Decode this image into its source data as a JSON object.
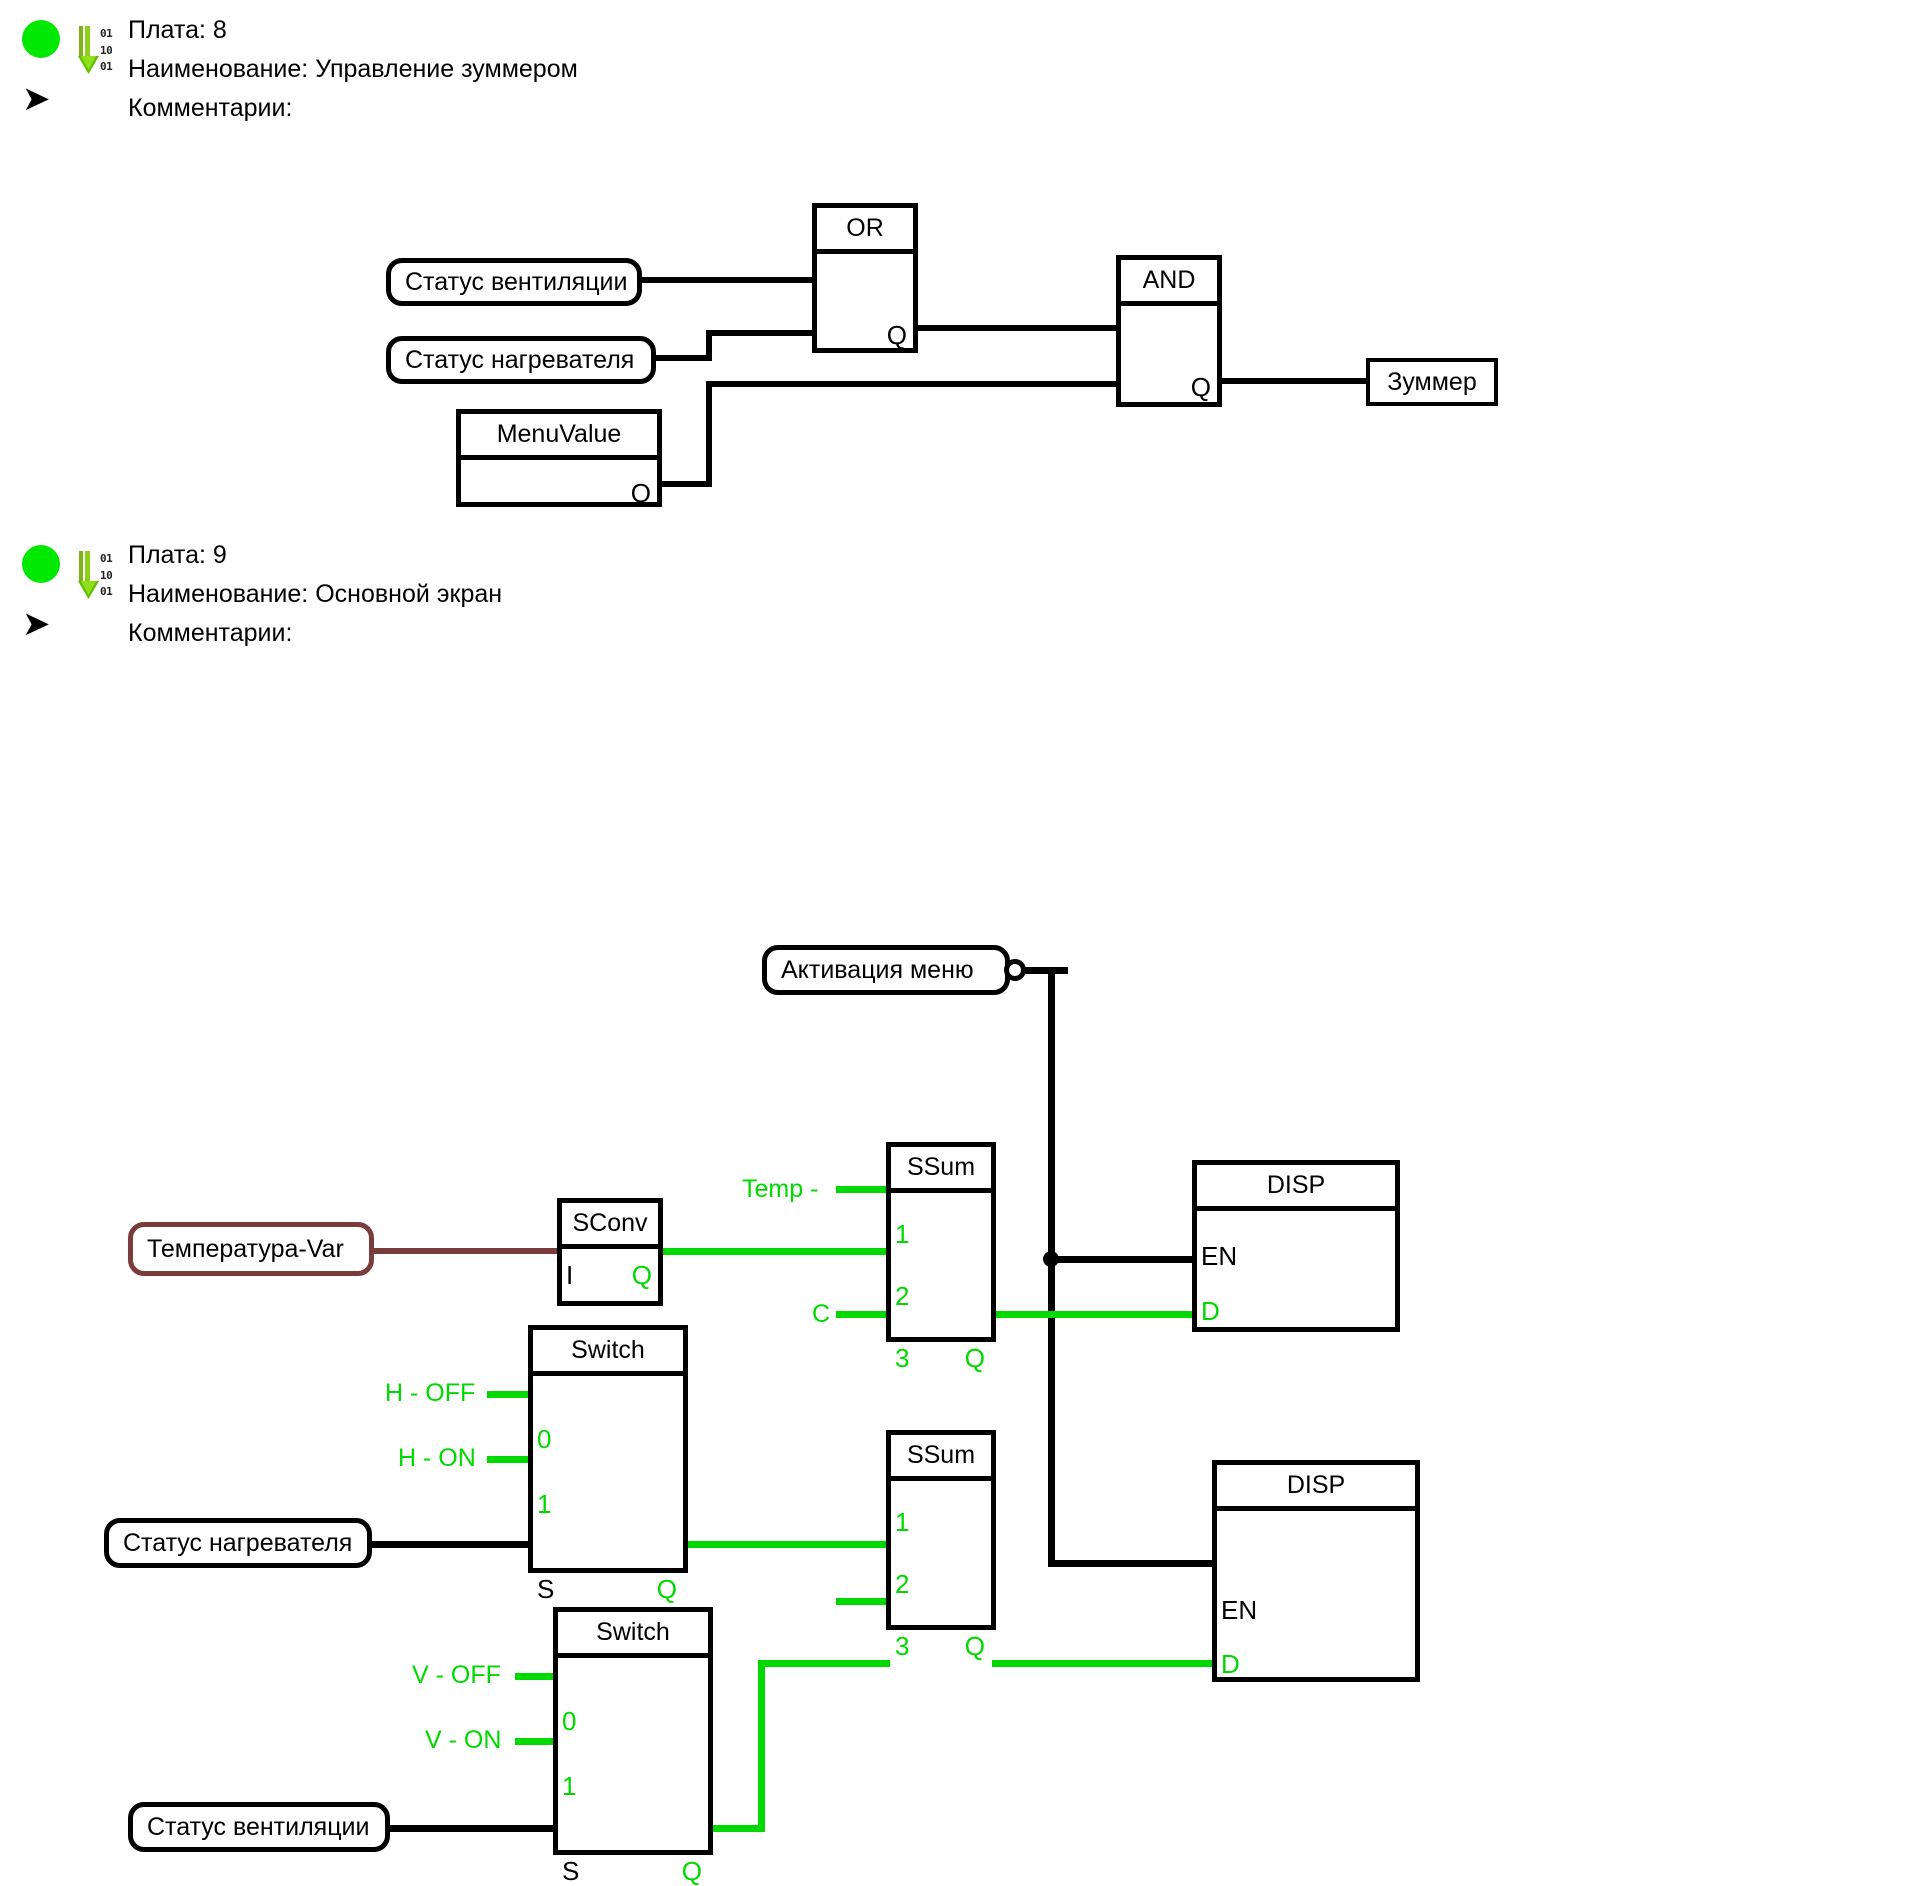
{
  "sections": [
    {
      "led_color": "#00E800",
      "icon_binary_rows": [
        "01",
        "10",
        "01"
      ],
      "lines": [
        "Плата: 8",
        "Наименование: Управление зуммером",
        "Комментарии:"
      ],
      "board_label": "Плата: 8",
      "name_label": "Наименование: Управление зуммером",
      "comments_label": "Комментарии:"
    },
    {
      "led_color": "#00E800",
      "icon_binary_rows": [
        "01",
        "10",
        "01"
      ],
      "lines": [
        "Плата: 9",
        "Наименование: Основной экран",
        "Комментарии:"
      ],
      "board_label": "Плата: 9",
      "name_label": "Наименование: Основной экран",
      "comments_label": "Комментарии:"
    }
  ],
  "diagram1": {
    "signals": {
      "vent_status": "Статус вентиляции",
      "heater_status": "Статус нагревателя",
      "buzzer": "Зуммер"
    },
    "blocks": {
      "menuvalue": {
        "title": "MenuValue",
        "out_q": "Q"
      },
      "or": {
        "title": "OR",
        "out_q": "Q"
      },
      "and": {
        "title": "AND",
        "out_q": "Q"
      }
    }
  },
  "diagram2": {
    "signals": {
      "menu_activation": "Активация  меню",
      "temperature_var": "Температура-Var",
      "heater_status": "Статус нагревателя",
      "vent_status": "Статус вентиляции"
    },
    "green_labels": {
      "temp_minus": "Temp -",
      "celsius": "C",
      "h_off": "H - OFF",
      "h_on": "H - ON",
      "v_off": "V - OFF",
      "v_on": "V - ON"
    },
    "blocks": {
      "sconv": {
        "title": "SConv",
        "in_i": "I",
        "out_q": "Q"
      },
      "ssum_top": {
        "title": "SSum",
        "in1": "1",
        "in2": "2",
        "in3": "3",
        "out_q": "Q"
      },
      "ssum_bot": {
        "title": "SSum",
        "in1": "1",
        "in2": "2",
        "in3": "3",
        "out_q": "Q"
      },
      "switch_h": {
        "title": "Switch",
        "in0": "0",
        "in1": "1",
        "in_s": "S",
        "out_q": "Q"
      },
      "switch_v": {
        "title": "Switch",
        "in0": "0",
        "in1": "1",
        "in_s": "S",
        "out_q": "Q"
      },
      "disp_top": {
        "title": "DISP",
        "in_en": "EN",
        "in_d": "D"
      },
      "disp_bot": {
        "title": "DISP",
        "in_en": "EN",
        "in_d": "D"
      }
    }
  },
  "colors": {
    "green_signal": "#00D900",
    "led_green": "#00E800",
    "brown_wire": "#7A3B3B",
    "black": "#000000"
  }
}
